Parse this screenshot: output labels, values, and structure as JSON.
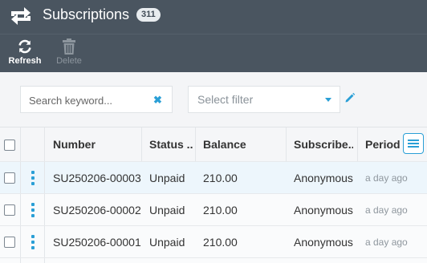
{
  "app": {
    "title": "Subscriptions",
    "count": "311",
    "logo_icon": "repeat-icon"
  },
  "toolbar": {
    "refresh": {
      "label": "Refresh",
      "icon": "refresh-icon"
    },
    "delete": {
      "label": "Delete",
      "icon": "trash-icon",
      "disabled": true
    }
  },
  "filters": {
    "search_placeholder": "Search keyword...",
    "search_value": "",
    "select_value": "Select filter"
  },
  "table": {
    "columns": [
      "Number",
      "Status ...",
      "Balance",
      "Subscribe...",
      "Period S"
    ],
    "rows": [
      {
        "number": "SU250206-00003",
        "status": "Unpaid",
        "balance": "210.00",
        "subscriber": "Anonymous",
        "period": "a day ago"
      },
      {
        "number": "SU250206-00002",
        "status": "Unpaid",
        "balance": "210.00",
        "subscriber": "Anonymous",
        "period": "a day ago"
      },
      {
        "number": "SU250206-00001",
        "status": "Unpaid",
        "balance": "210.00",
        "subscriber": "Anonymous",
        "period": "a day ago"
      }
    ]
  },
  "colors": {
    "header_bg": "#4a5560",
    "accent": "#2a9fd6",
    "selected_row": "#edf6fc"
  }
}
